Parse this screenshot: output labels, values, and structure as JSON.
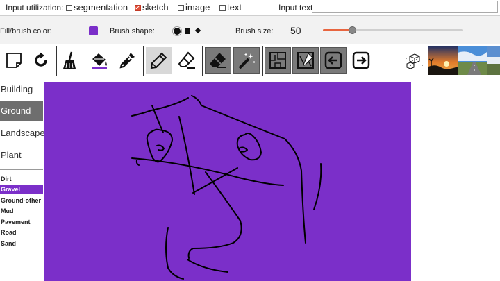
{
  "top": {
    "input_label": "Input utilization:",
    "options": [
      {
        "label": "segmentation",
        "checked": false
      },
      {
        "label": "sketch",
        "checked": true
      },
      {
        "label": "image",
        "checked": false
      },
      {
        "label": "text",
        "checked": false
      }
    ],
    "text_label": "Input text:",
    "text_value": ""
  },
  "brush": {
    "fill_label": "Fill/brush color:",
    "fill_color": "#7b2fc9",
    "shape_label": "Brush shape:",
    "shapes": [
      "circle",
      "square",
      "diamond"
    ],
    "selected_shape": "circle",
    "size_label": "Brush size:",
    "size": "50",
    "size_fraction": 0.21
  },
  "toolbar": {
    "tools": [
      {
        "name": "new-page-icon"
      },
      {
        "name": "redo-icon"
      },
      {
        "name": "broom-icon"
      },
      {
        "name": "paint-bucket-icon"
      },
      {
        "name": "eyedropper-icon"
      },
      {
        "name": "pencil-icon",
        "selected": true
      },
      {
        "name": "line-eraser-icon"
      },
      {
        "name": "eraser-icon"
      },
      {
        "name": "magic-wand-icon"
      },
      {
        "name": "segment-map-icon"
      },
      {
        "name": "sketch-map-icon"
      },
      {
        "name": "previous-icon"
      },
      {
        "name": "next-icon"
      },
      {
        "name": "random-dice-icon"
      }
    ]
  },
  "sidebar": {
    "categories": [
      {
        "label": "Building",
        "selected": false
      },
      {
        "label": "Ground",
        "selected": true
      },
      {
        "label": "Landscape",
        "selected": false
      },
      {
        "label": "Plant",
        "selected": false
      }
    ],
    "subcategories": [
      {
        "label": "Dirt",
        "selected": false
      },
      {
        "label": "Gravel",
        "selected": true
      },
      {
        "label": "Ground-other",
        "selected": false
      },
      {
        "label": "Mud",
        "selected": false
      },
      {
        "label": "Pavement",
        "selected": false
      },
      {
        "label": "Road",
        "selected": false
      },
      {
        "label": "Sand",
        "selected": false
      }
    ]
  },
  "canvas": {
    "background": "#7b2fc9",
    "stroke_color": "#000000"
  }
}
